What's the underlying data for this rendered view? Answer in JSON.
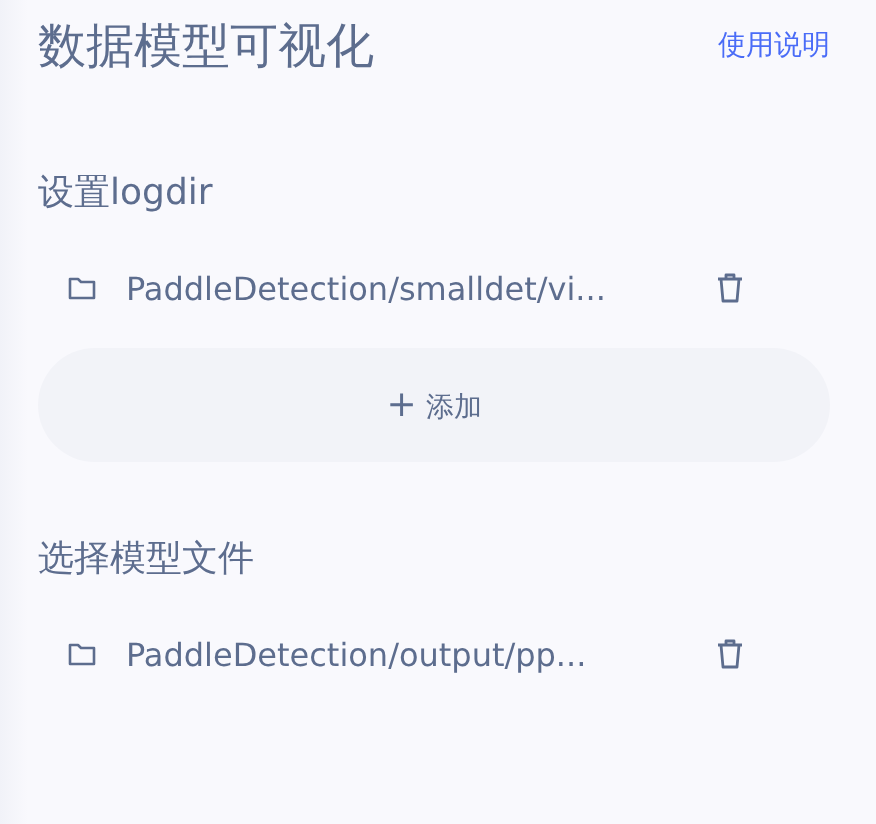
{
  "header": {
    "title": "数据模型可视化",
    "help_link": "使用说明"
  },
  "sections": [
    {
      "title": "设置logdir",
      "items": [
        {
          "path": "PaddleDetection/smalldet/vi..."
        }
      ],
      "add_button": {
        "icon": "+",
        "label": "添加"
      }
    },
    {
      "title": "选择模型文件",
      "items": [
        {
          "path": "PaddleDetection/output/pp..."
        }
      ]
    }
  ]
}
